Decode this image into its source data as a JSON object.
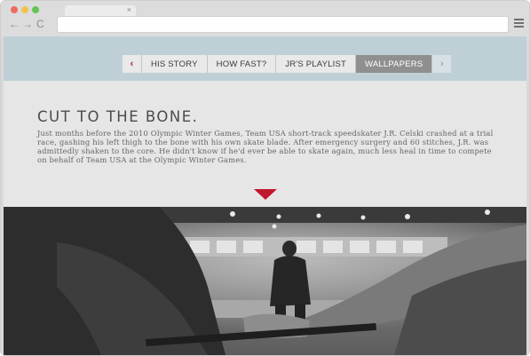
{
  "browser": {
    "tab_close": "×",
    "back_glyph": "←",
    "forward_glyph": "→",
    "reload_glyph": "C",
    "url_placeholder": ""
  },
  "nav": {
    "prev_arrow": "‹",
    "next_arrow": "›",
    "tabs": [
      {
        "label": "HIS STORY",
        "active": false
      },
      {
        "label": "HOW FAST?",
        "active": false
      },
      {
        "label": "JR'S PLAYLIST",
        "active": false
      },
      {
        "label": "WALLPAPERS",
        "active": true
      }
    ]
  },
  "article": {
    "headline": "CUT TO THE BONE.",
    "body": "Just months before the 2010 Olympic Winter Games, Team USA short-track speedskater J.R. Celski crashed at a trial race, gashing his left thigh to the bone with his own skate blade. After emergency surgery and 60 stitches, J.R. was admittedly shaken to the core. He didn't know if he'd ever be able to skate again, much less heal in time to compete on behalf of Team USA at the Olympic Winter Games."
  },
  "colors": {
    "accent_red": "#c1172e",
    "nav_band": "#bed0d6",
    "active_tab": "#8f8f8f"
  }
}
